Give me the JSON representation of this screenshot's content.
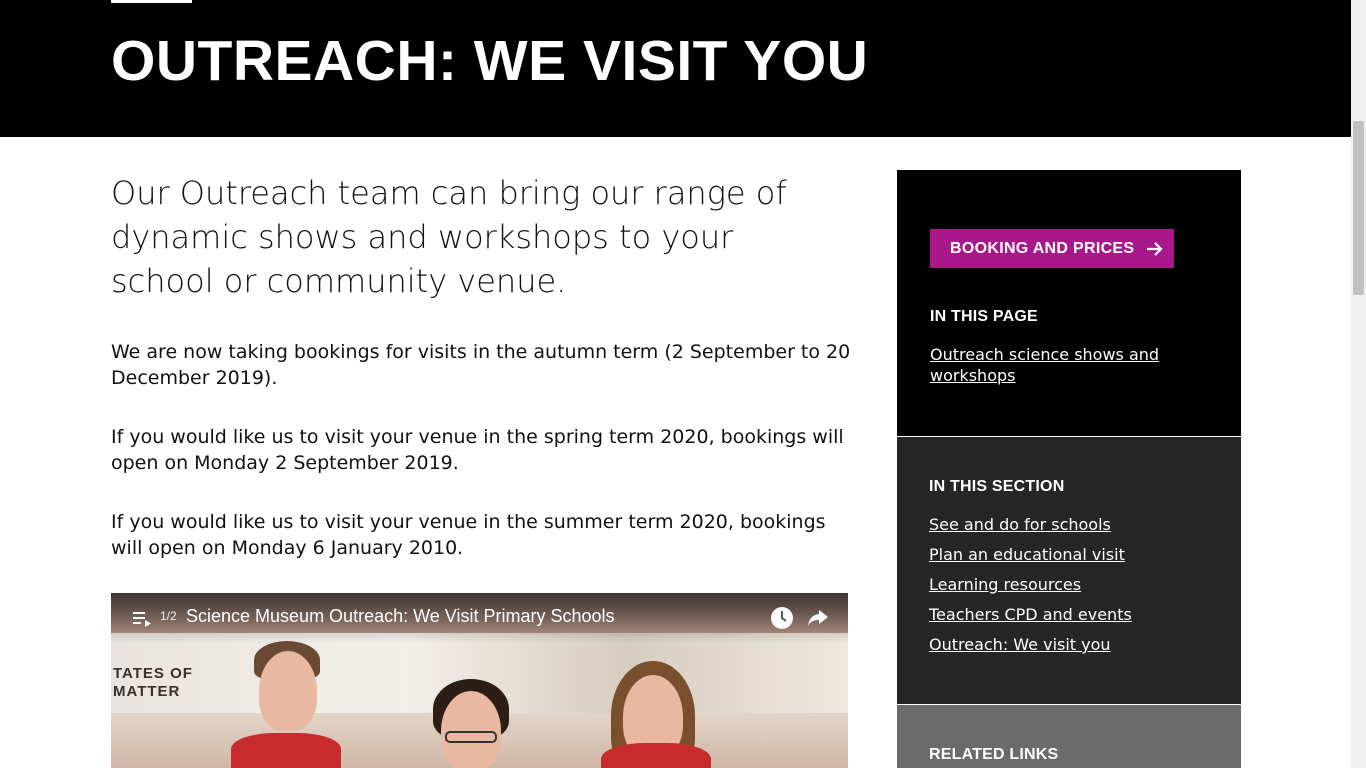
{
  "hero": {
    "title": "OUTREACH: WE VISIT YOU"
  },
  "main": {
    "lead": "Our Outreach team can bring our range of dynamic shows and workshops to your school or community venue.",
    "paragraphs": [
      "We are now taking bookings for visits in the autumn term (2 September to 20 December 2019).",
      "If you would like us to visit your venue in the spring term 2020, bookings will open on Monday 2 September 2019.",
      "If you would like us to visit your venue in the summer term 2020, bookings will open on Monday 6 January 2010."
    ],
    "video": {
      "playlist_count": "1/2",
      "title": "Science Museum Outreach: We Visit Primary Schools",
      "scene_sign": "TATES OF\nMATTER",
      "icons": [
        "playlist-icon",
        "clock-icon",
        "share-icon"
      ]
    }
  },
  "sidebar": {
    "booking_button": "BOOKING AND PRICES",
    "in_this_page": {
      "heading": "IN THIS PAGE",
      "links": [
        "Outreach science shows and workshops"
      ]
    },
    "in_this_section": {
      "heading": "IN THIS SECTION",
      "links": [
        "See and do for schools",
        "Plan an educational visit",
        "Learning resources",
        "Teachers CPD and events",
        "Outreach: We visit you"
      ]
    },
    "related_links": {
      "heading": "RELATED LINKS"
    }
  },
  "colors": {
    "hero_bg": "#000000",
    "accent": "#a8188b",
    "section_bg": "#262626",
    "related_bg": "#6b6b6b"
  }
}
